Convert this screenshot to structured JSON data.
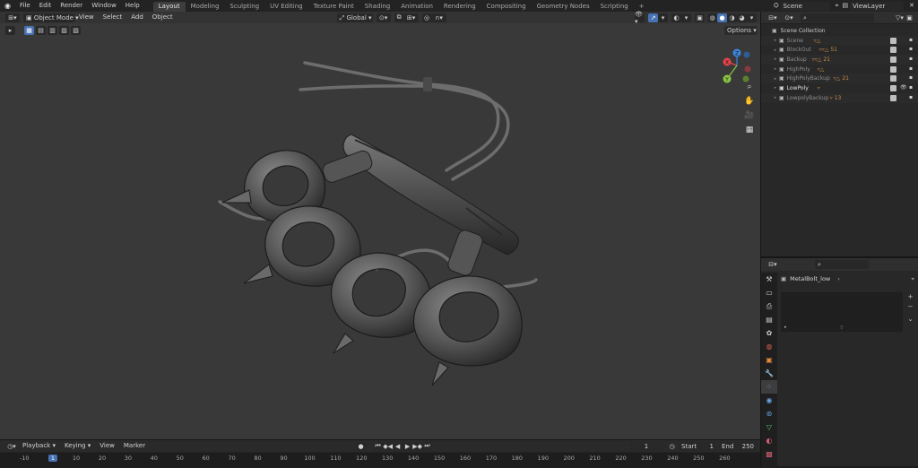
{
  "menu": [
    "File",
    "Edit",
    "Render",
    "Window",
    "Help"
  ],
  "workspaces": [
    "Layout",
    "Modeling",
    "Sculpting",
    "UV Editing",
    "Texture Paint",
    "Shading",
    "Animation",
    "Rendering",
    "Compositing",
    "Geometry Nodes",
    "Scripting"
  ],
  "active_workspace": "Layout",
  "add_tab": "+",
  "scene": {
    "name": "Scene"
  },
  "view_layer": {
    "name": "ViewLayer"
  },
  "viewport": {
    "mode": "Object Mode",
    "menus": [
      "View",
      "Select",
      "Add",
      "Object"
    ],
    "transform": "Global",
    "options": "Options",
    "gizmo": {
      "x": "X",
      "y": "Y",
      "z": "Z"
    }
  },
  "outliner": {
    "title": "Scene Collection",
    "items": [
      {
        "name": "Scene",
        "eye": "",
        "highlight": false
      },
      {
        "name": "BlockOut",
        "badge": "51",
        "eye": "",
        "highlight": false
      },
      {
        "name": "Backup",
        "badge": "21",
        "eye": "",
        "highlight": false
      },
      {
        "name": "HighPoly",
        "eye": "",
        "highlight": false
      },
      {
        "name": "HighPolyBackup",
        "badge": "21",
        "eye": "",
        "highlight": false
      },
      {
        "name": "LowPoly",
        "eye": "👁",
        "highlight": true
      },
      {
        "name": "LowpolyBackup",
        "badge": "13",
        "eye": "",
        "highlight": false
      }
    ]
  },
  "properties": {
    "object_name": "MetalBolt_low"
  },
  "timeline": {
    "menus": [
      "Playback",
      "Keying",
      "View",
      "Marker"
    ],
    "current_frame": "1",
    "start_label": "Start",
    "start": "1",
    "end_label": "End",
    "end": "250",
    "ticks": [
      "-10",
      "1",
      "10",
      "20",
      "30",
      "40",
      "50",
      "60",
      "70",
      "80",
      "90",
      "100",
      "110",
      "120",
      "130",
      "140",
      "150",
      "160",
      "170",
      "180",
      "190",
      "200",
      "210",
      "220",
      "230",
      "240",
      "250",
      "260"
    ],
    "tick_values": [
      -10,
      1,
      10,
      20,
      30,
      40,
      50,
      60,
      70,
      80,
      90,
      100,
      110,
      120,
      130,
      140,
      150,
      160,
      170,
      180,
      190,
      200,
      210,
      220,
      230,
      240,
      250,
      260
    ]
  },
  "colors": {
    "accent": "#4772b3",
    "x_axis": "#e5424a",
    "y_axis": "#8ac541",
    "z_axis": "#3c84dd",
    "collection_icon": "#c98a4a"
  }
}
